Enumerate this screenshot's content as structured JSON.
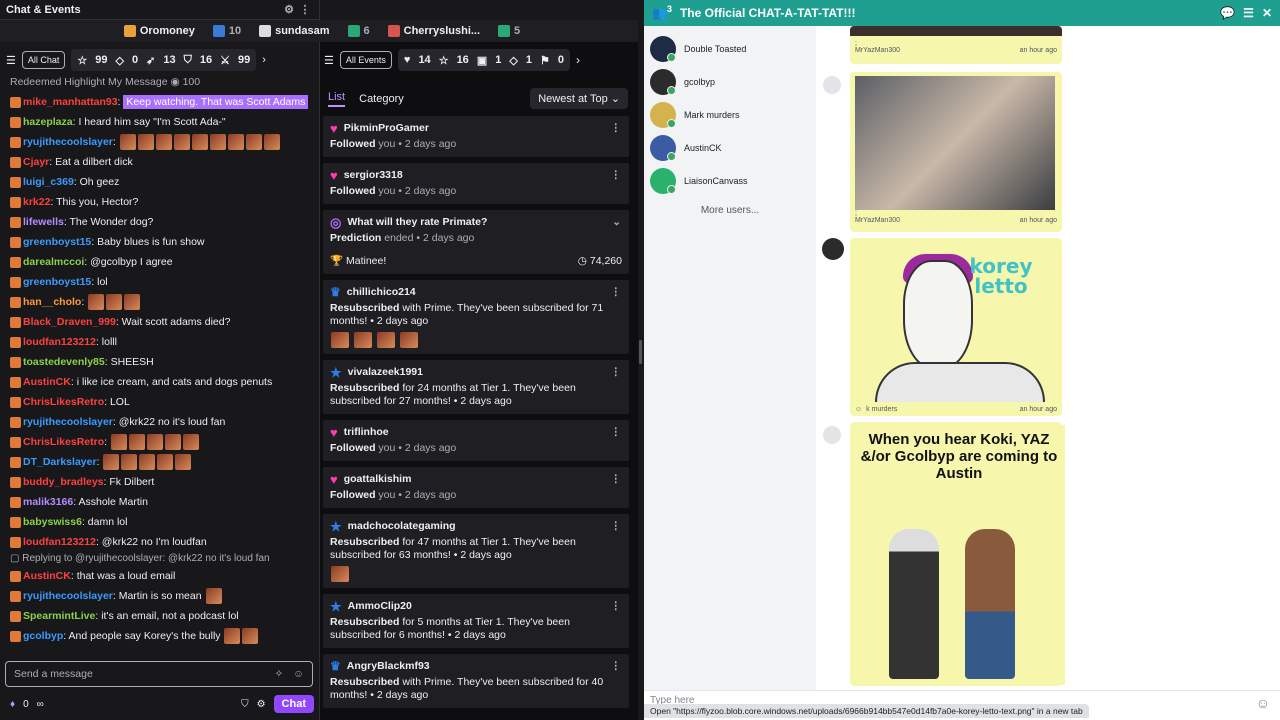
{
  "chat": {
    "title": "Chat & Events",
    "all_chat": "All Chat",
    "stats": [
      "99",
      "0",
      "13",
      "16",
      "99"
    ],
    "messages": [
      {
        "type": "sys",
        "text": "Redeemed Highlight My Message",
        "cost": "100"
      },
      {
        "user": "mike_manhattan93",
        "color": "#ff4040",
        "text": "Keep watching. That was Scott Adams",
        "highlight": true
      },
      {
        "user": "hazeplaza",
        "color": "#8bd14b",
        "text": "I heard him say \"I'm Scott Ada-\""
      },
      {
        "user": "ryujithecoolslayer",
        "color": "#3a9bff",
        "text": "",
        "emotes": 9
      },
      {
        "user": "Cjayr",
        "color": "#ff4040",
        "text": "Eat a dilbert dick"
      },
      {
        "user": "luigi_c369",
        "color": "#3a9bff",
        "text": "Oh geez"
      },
      {
        "user": "krk22",
        "color": "#ff4040",
        "text": "This you, Hector?"
      },
      {
        "user": "lifewells",
        "color": "#b58cff",
        "text": "The Wonder dog?"
      },
      {
        "user": "greenboyst15",
        "color": "#3a9bff",
        "text": "Baby blues is fun show"
      },
      {
        "user": "darealmccoi",
        "color": "#8bd14b",
        "text": "@gcolbyp I agree"
      },
      {
        "user": "greenboyst15",
        "color": "#3a9bff",
        "text": "lol"
      },
      {
        "user": "han__cholo",
        "color": "#ff9a3a",
        "text": "",
        "emotes": 3
      },
      {
        "user": "Black_Draven_999",
        "color": "#ff4040",
        "text": "Wait scott adams died?"
      },
      {
        "user": "loudfan123212",
        "color": "#ff4040",
        "text": "lolll"
      },
      {
        "user": "toastedevenly85",
        "color": "#8bd14b",
        "text": "SHEESH"
      },
      {
        "user": "AustinCK",
        "color": "#ff4040",
        "text": "i like ice cream, and cats and dogs penuts"
      },
      {
        "user": "ChrisLikesRetro",
        "color": "#ff4040",
        "text": "LOL"
      },
      {
        "user": "ryujithecoolslayer",
        "color": "#3a9bff",
        "text": "@krk22 no it's loud fan"
      },
      {
        "user": "ChrisLikesRetro",
        "color": "#ff4040",
        "text": "",
        "emotes": 5
      },
      {
        "user": "DT_Darkslayer",
        "color": "#3a9bff",
        "text": "",
        "emotes": 5
      },
      {
        "user": "buddy_bradleys",
        "color": "#ff4040",
        "text": "Fk Dilbert"
      },
      {
        "user": "malik3166",
        "color": "#b58cff",
        "text": "Asshole Martin"
      },
      {
        "user": "babyswiss6",
        "color": "#8bd14b",
        "text": "damn lol"
      },
      {
        "user": "loudfan123212",
        "color": "#ff4040",
        "text": "@krk22 no I'm loudfan"
      },
      {
        "type": "reply",
        "text": "Replying to @ryujithecoolslayer: @krk22 no it's loud fan"
      },
      {
        "user": "AustinCK",
        "color": "#ff4040",
        "text": "that was a loud email"
      },
      {
        "user": "ryujithecoolslayer",
        "color": "#3a9bff",
        "text": "Martin is so mean",
        "emotes": 1
      },
      {
        "user": "SpearmintLive",
        "color": "#8bd14b",
        "text": "it's an email, not a podcast lol"
      },
      {
        "user": "gcolbyp",
        "color": "#3a9bff",
        "text": "And people say Korey's the bully",
        "emotes": 2
      }
    ],
    "composer_placeholder": "Send a message",
    "footer_points": "0",
    "footer_infinity": "∞",
    "chat_button": "Chat"
  },
  "topbar": [
    {
      "name": "Oromoney",
      "color": "#e9a13b"
    },
    {
      "name": "",
      "count": "10",
      "color": "#3a7bd5"
    },
    {
      "name": "sundasam",
      "color": "#dddddd"
    },
    {
      "name": "",
      "count": "6",
      "color": "#2aa876"
    },
    {
      "name": "Cherryslushi...",
      "color": "#d9534f"
    },
    {
      "name": "",
      "count": "5",
      "color": "#2aa876"
    }
  ],
  "events": {
    "all_events": "All Events",
    "stats": [
      "14",
      "16",
      "1",
      "1",
      "0"
    ],
    "tabs": {
      "list": "List",
      "category": "Category",
      "sort": "Newest at Top"
    },
    "cards": [
      {
        "kind": "follow",
        "user": "PikminProGamer",
        "action": "Followed",
        "suffix": "you • 2 days ago"
      },
      {
        "kind": "follow",
        "user": "sergior3318",
        "action": "Followed",
        "suffix": "you • 2 days ago"
      },
      {
        "kind": "prediction",
        "user": "What will they rate Primate?",
        "action": "Prediction",
        "suffix": "ended • 2 days ago",
        "outcome": "Matinee!",
        "points": "74,260"
      },
      {
        "kind": "prime",
        "user": "chillichico214",
        "action": "Resubscribed",
        "text": "with Prime. They've been subscribed for 71 months! • 2 days ago",
        "emotes": 4
      },
      {
        "kind": "sub",
        "user": "vivalazeek1991",
        "action": "Resubscribed",
        "text": "for 24 months at Tier 1. They've been subscribed for 27 months! • 2 days ago"
      },
      {
        "kind": "follow",
        "user": "triflinhoe",
        "action": "Followed",
        "suffix": "you • 2 days ago"
      },
      {
        "kind": "follow",
        "user": "goattalkishim",
        "action": "Followed",
        "suffix": "you • 2 days ago"
      },
      {
        "kind": "sub",
        "user": "madchocolategaming",
        "action": "Resubscribed",
        "text": "for 47 months at Tier 1. They've been subscribed for 63 months! • 2 days ago",
        "emotes": 1
      },
      {
        "kind": "sub",
        "user": "AmmoClip20",
        "action": "Resubscribed",
        "text": "for 5 months at Tier 1. They've been subscribed for 6 months! • 2 days ago"
      },
      {
        "kind": "prime",
        "user": "AngryBlackmf93",
        "action": "Resubscribed",
        "text": "with Prime. They've been subscribed for 40 months! • 2 days ago"
      }
    ]
  },
  "discord": {
    "badge_count": "3",
    "title": "The Official CHAT-A-TAT-TAT!!!",
    "users": [
      {
        "name": "Double Toasted",
        "color": "#1f2a44"
      },
      {
        "name": "gcolbyp",
        "color": "#2b2b2b"
      },
      {
        "name": "Mark murders",
        "color": "#d4b24c"
      },
      {
        "name": "AustinCK",
        "color": "#3b5ba5"
      },
      {
        "name": "LiaisonCanvass",
        "color": "#2ab26d"
      }
    ],
    "more_users": "More users...",
    "messages": [
      {
        "author": "MrYazMan300",
        "time": "an hour ago"
      },
      {
        "author": "MrYazMan300",
        "time": "an hour ago"
      },
      {
        "author": "k murders",
        "time": "an hour ago",
        "art_text": "korey letto"
      },
      {
        "poster": "When you hear Koki, YAZ &/or Gcolbyp are coming to Austin"
      }
    ],
    "input_placeholder": "Type here",
    "status_url": "Open \"https://flyzoo.blob.core.windows.net/uploads/6966b914bb547e0d14fb7a0e-korey-letto-text.png\" in a new tab"
  }
}
